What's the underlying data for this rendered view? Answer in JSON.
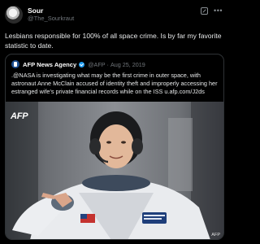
{
  "tweet": {
    "display_name": "Sour",
    "handle": "@The_Sourkraut",
    "text": "Lesbians responsible for 100% of all space crime. Is by far my favorite statistic to date."
  },
  "quoted": {
    "display_name": "AFP News Agency",
    "handle": "@AFP",
    "separator": "·",
    "date": "Aug 25, 2019",
    "text": ".@NASA is investigating what may be the first crime in outer space, with astronaut Anne McClain accused of identity theft and improperly accessing her estranged wife's private financial records while on the ISS u.afp.com/J2ds",
    "photo": {
      "logo_text": "AFP",
      "credit": "AFP"
    }
  },
  "colors": {
    "background": "#000000",
    "text": "#e7e9ea",
    "secondary": "#71767b",
    "border": "#2f3336",
    "verified": "#1d9bf0"
  },
  "icons": [
    "grok-icon",
    "more-icon",
    "verified-icon"
  ]
}
